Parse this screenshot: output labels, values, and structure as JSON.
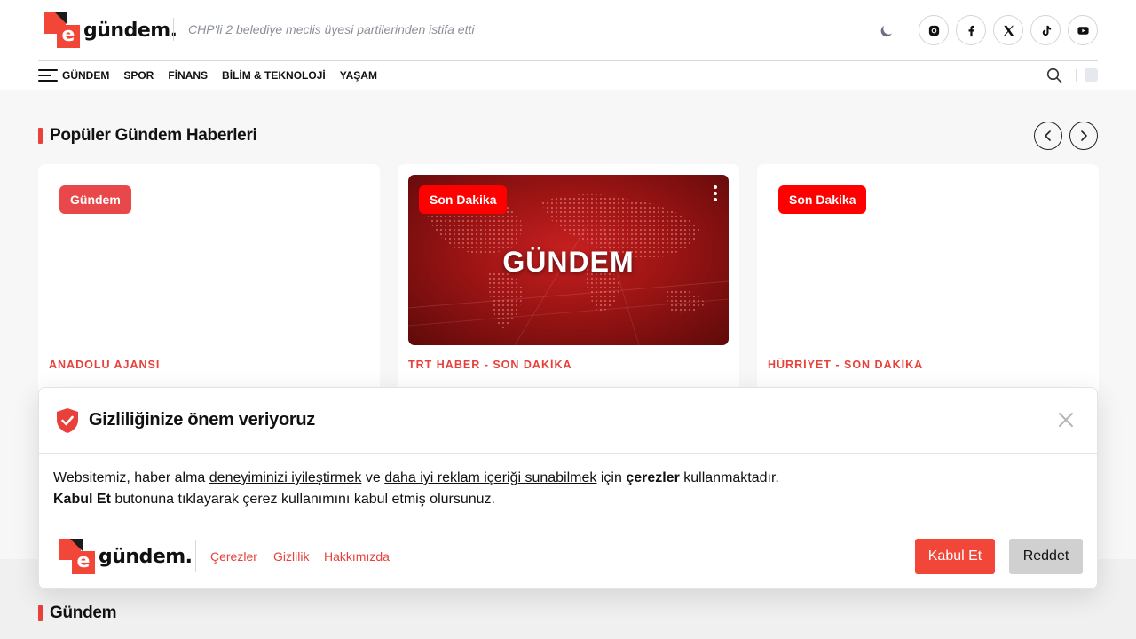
{
  "brand": {
    "logo_letter": "e",
    "logo_word": "gündem."
  },
  "ticker": {
    "text": "CHP'li 2 belediye meclis üyesi partilerinden istifa etti"
  },
  "socials": [
    "instagram-icon",
    "facebook-icon",
    "x-icon",
    "tiktok-icon",
    "youtube-icon"
  ],
  "nav": {
    "items": [
      "GÜNDEM",
      "SPOR",
      "FİNANS",
      "BİLİM & TEKNOLOJİ",
      "YAŞAM"
    ]
  },
  "popular": {
    "title": "Popüler Gündem Haberleri",
    "cards": [
      {
        "badge": "Gündem",
        "badge_color": "#e8484a",
        "source": "ANADOLU AJANSI",
        "image_text": ""
      },
      {
        "badge": "Son Dakika",
        "badge_color": "#ff0000",
        "source": "TRT HABER - SON DAKİKA",
        "image_text": "GÜNDEM"
      },
      {
        "badge": "Son Dakika",
        "badge_color": "#ff0000",
        "source": "HÜRRİYET - SON DAKİKA",
        "image_text": ""
      }
    ]
  },
  "second_section": {
    "title": "Gündem"
  },
  "cookie": {
    "title": "Gizliliğinize önem veriyoruz",
    "body_1": "Websitemiz, haber alma ",
    "link_1": "deneyiminizi iyileştirmek",
    "body_2": " ve ",
    "link_2": "daha iyi reklam içeriği sunabilmek",
    "body_3": " için ",
    "bold_1": "çerezler",
    "body_4": " kullanmaktadır.",
    "bold_2": "Kabul Et",
    "body_5": " butonuna tıklayarak çerez kullanımını kabul etmiş olursunuz.",
    "links": [
      "Çerezler",
      "Gizlilik",
      "Hakkımızda"
    ],
    "accept": "Kabul Et",
    "reject": "Reddet"
  },
  "colors": {
    "accent": "#f24738",
    "breaking": "#ff0000"
  }
}
